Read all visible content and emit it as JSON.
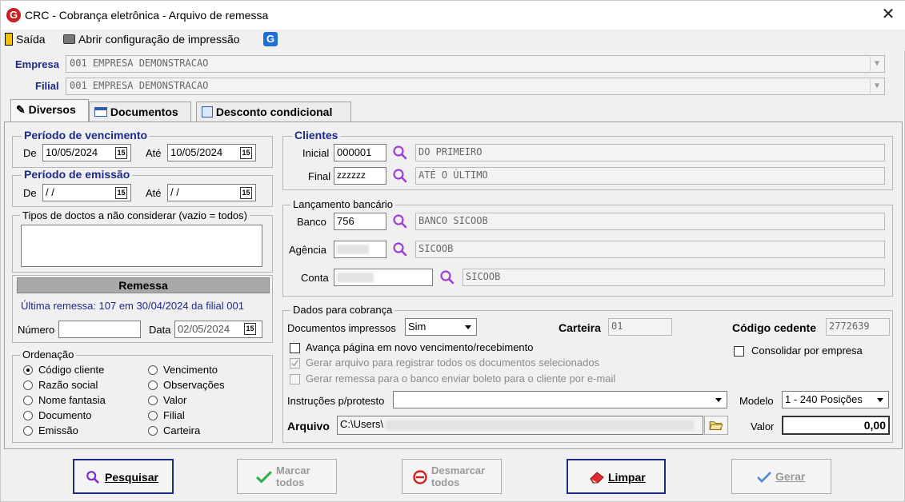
{
  "window": {
    "title": "CRC - Cobrança eletrônica - Arquivo de remessa"
  },
  "toolbar": {
    "exit_label": "Saída",
    "print_config_label": "Abrir configuração de impressão"
  },
  "company": {
    "empresa_label": "Empresa",
    "empresa_value": "001 EMPRESA DEMONSTRACAO",
    "filial_label": "Filial",
    "filial_value": "001 EMPRESA DEMONSTRACAO"
  },
  "tabs": [
    {
      "label": "Diversos"
    },
    {
      "label": "Documentos"
    },
    {
      "label": "Desconto condicional"
    }
  ],
  "vencimento": {
    "title": "Período de vencimento",
    "de_label": "De",
    "de_value": "10/05/2024",
    "ate_label": "Até",
    "ate_value": "10/05/2024"
  },
  "emissao": {
    "title": "Período de emissão",
    "de_label": "De",
    "de_value": " / /",
    "ate_label": "Até",
    "ate_value": " / /"
  },
  "tipos": {
    "title": "Tipos de doctos a não considerar (vazio = todos)"
  },
  "remessa": {
    "title": "Remessa",
    "ultima": "Última remessa: 107 em 30/04/2024 da filial 001",
    "numero_label": "Número",
    "data_label": "Data",
    "data_value": "02/05/2024"
  },
  "ordenacao": {
    "title": "Ordenação",
    "left": [
      "Código cliente",
      "Razão social",
      "Nome fantasia",
      "Documento",
      "Emissão"
    ],
    "right": [
      "Vencimento",
      "Observações",
      "Valor",
      "Filial",
      "Carteira"
    ],
    "selected": "Código cliente"
  },
  "clientes": {
    "title": "Clientes",
    "inicial_label": "Inicial",
    "inicial_value": "000001",
    "inicial_desc": "DO PRIMEIRO",
    "final_label": "Final",
    "final_value": "zzzzzz",
    "final_desc": "ATÉ O ÚLTIMO"
  },
  "lancamento": {
    "title": "Lançamento bancário",
    "banco_label": "Banco",
    "banco_value": "756",
    "banco_desc": "BANCO SICOOB",
    "agencia_label": "Agência",
    "agencia_desc": "SICOOB",
    "conta_label": "Conta",
    "conta_desc": "SICOOB"
  },
  "cobranca": {
    "title": "Dados para cobrança",
    "docs_label": "Documentos impressos",
    "docs_value": "Sim",
    "carteira_label": "Carteira",
    "carteira_value": "01",
    "cedente_label": "Código cedente",
    "cedente_value": "2772639",
    "chk_avanca": "Avança página em novo vencimento/recebimento",
    "chk_gerar_arquivo": "Gerar arquivo para registrar todos os documentos selecionados",
    "chk_gerar_remessa": "Gerar remessa para o banco enviar boleto para o cliente por e-mail",
    "chk_consolidar": "Consolidar por empresa",
    "instrucoes_label": "Instruções p/protesto",
    "modelo_label": "Modelo",
    "modelo_value": "1 - 240 Posições",
    "arquivo_label": "Arquivo",
    "arquivo_value": "C:\\Users\\",
    "valor_label": "Valor",
    "valor_value": "0,00"
  },
  "buttons": {
    "pesquisar": "Pesquisar",
    "marcar": "Marcar todos",
    "desmarcar": "Desmarcar todos",
    "limpar": "Limpar",
    "gerar": "Gerar"
  }
}
